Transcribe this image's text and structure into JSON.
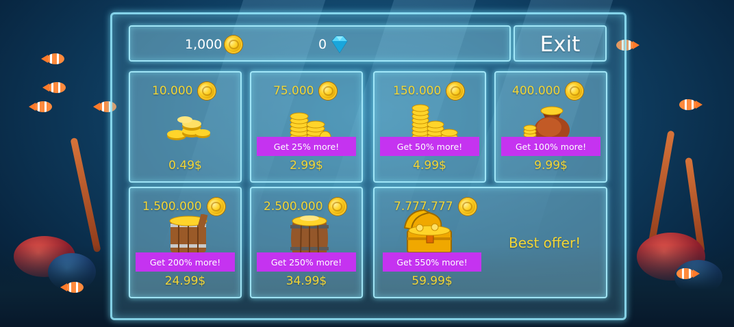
{
  "hud": {
    "coins": "1,000",
    "gems": "0",
    "exit_label": "Exit"
  },
  "offers": [
    {
      "amount": "10.000",
      "bonus": "",
      "price": "0.49$",
      "art": "coin-pile-small"
    },
    {
      "amount": "75.000",
      "bonus": "Get 25% more!",
      "price": "2.99$",
      "art": "coin-stacks"
    },
    {
      "amount": "150.000",
      "bonus": "Get 50% more!",
      "price": "4.99$",
      "art": "coin-stacks-large"
    },
    {
      "amount": "400.000",
      "bonus": "Get 100% more!",
      "price": "9.99$",
      "art": "coin-sack"
    },
    {
      "amount": "1.500.000",
      "bonus": "Get 200% more!",
      "price": "24.99$",
      "art": "coin-bucket"
    },
    {
      "amount": "2.500.000",
      "bonus": "Get 250% more!",
      "price": "34.99$",
      "art": "coin-barrel"
    },
    {
      "amount": "7.777.777",
      "bonus": "Get 550% more!",
      "price": "59.99$",
      "art": "treasure-chest",
      "tag": "Best offer!"
    }
  ],
  "colors": {
    "accent_gold": "#f3d636",
    "bonus_banner": "#c533f0",
    "glass_border": "#aaf0ff"
  }
}
